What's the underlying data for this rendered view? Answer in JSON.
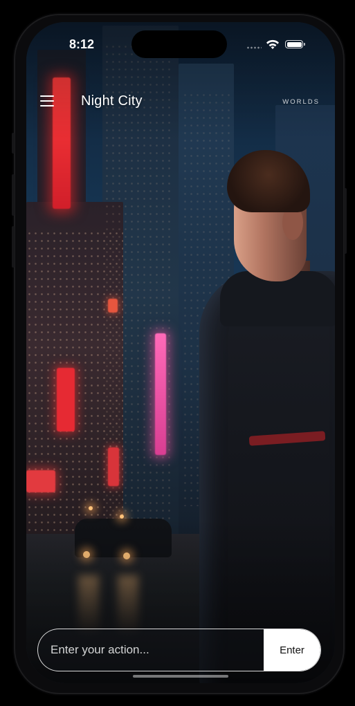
{
  "status_bar": {
    "time": "8:12"
  },
  "header": {
    "title": "Night City",
    "worlds_label": "WORLDS",
    "menu_icon": "hamburger-menu-icon"
  },
  "action_bar": {
    "placeholder": "Enter your action...",
    "value": "",
    "submit_label": "Enter"
  },
  "colors": {
    "background": "#000000",
    "text": "#ffffff",
    "button_bg": "#ffffff",
    "button_text": "#111111",
    "neon_red": "#e62a33",
    "neon_pink": "#ff6ab8"
  },
  "icons": {
    "status": [
      "cellular-signal-icon",
      "wifi-icon",
      "battery-icon"
    ]
  }
}
